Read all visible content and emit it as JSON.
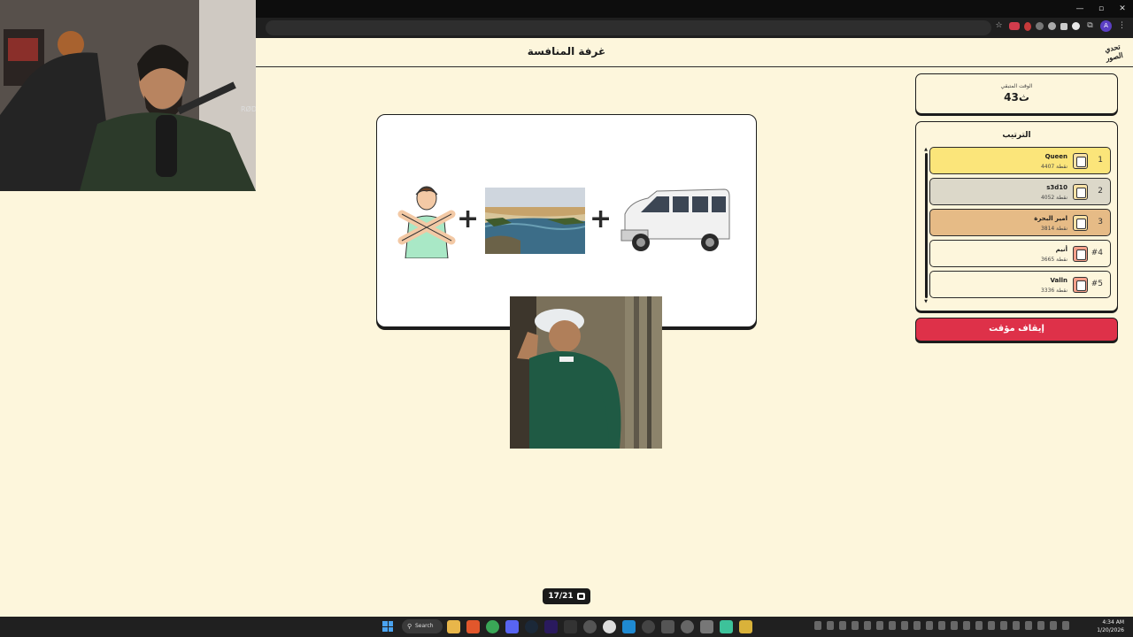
{
  "app": {
    "title": "غرفة المنافسة",
    "logo_text": "تحدي الصور"
  },
  "timer": {
    "label": "الوقت المتبقي",
    "value": "43ث"
  },
  "leaderboard": {
    "title": "الترتيب",
    "entries": [
      {
        "rank": "1",
        "name": "Queen",
        "points": "4407 نقطة",
        "color": "#fbe57a"
      },
      {
        "rank": "2",
        "name": "s3d10",
        "points": "4052 نقطة",
        "color": "#dcd8c9"
      },
      {
        "rank": "3",
        "name": "امير البحرة",
        "points": "3814 نقطة",
        "color": "#e6bb86"
      },
      {
        "rank": "#4",
        "name": "أنيم",
        "points": "3665 نقطة",
        "color": "#fdf6dc"
      },
      {
        "rank": "#5",
        "name": "Valln",
        "points": "3336 نقطة",
        "color": "#fdf6dc"
      }
    ]
  },
  "controls": {
    "stop_label": "إيقاف مؤقت"
  },
  "progress": {
    "label": "17/21"
  },
  "puzzle": {
    "items": [
      "person-crossed-arms",
      "nile-river",
      "white-van"
    ],
    "operator": "+"
  },
  "taskbar": {
    "search_label": "Search",
    "time": "4:34 AM",
    "date": "1/20/2026"
  },
  "colors": {
    "page_bg": "#fdf6dc",
    "accent_red": "#de3149",
    "first_place": "#fbe57a",
    "second_place": "#dcd8c9",
    "third_place": "#e6bb86"
  }
}
